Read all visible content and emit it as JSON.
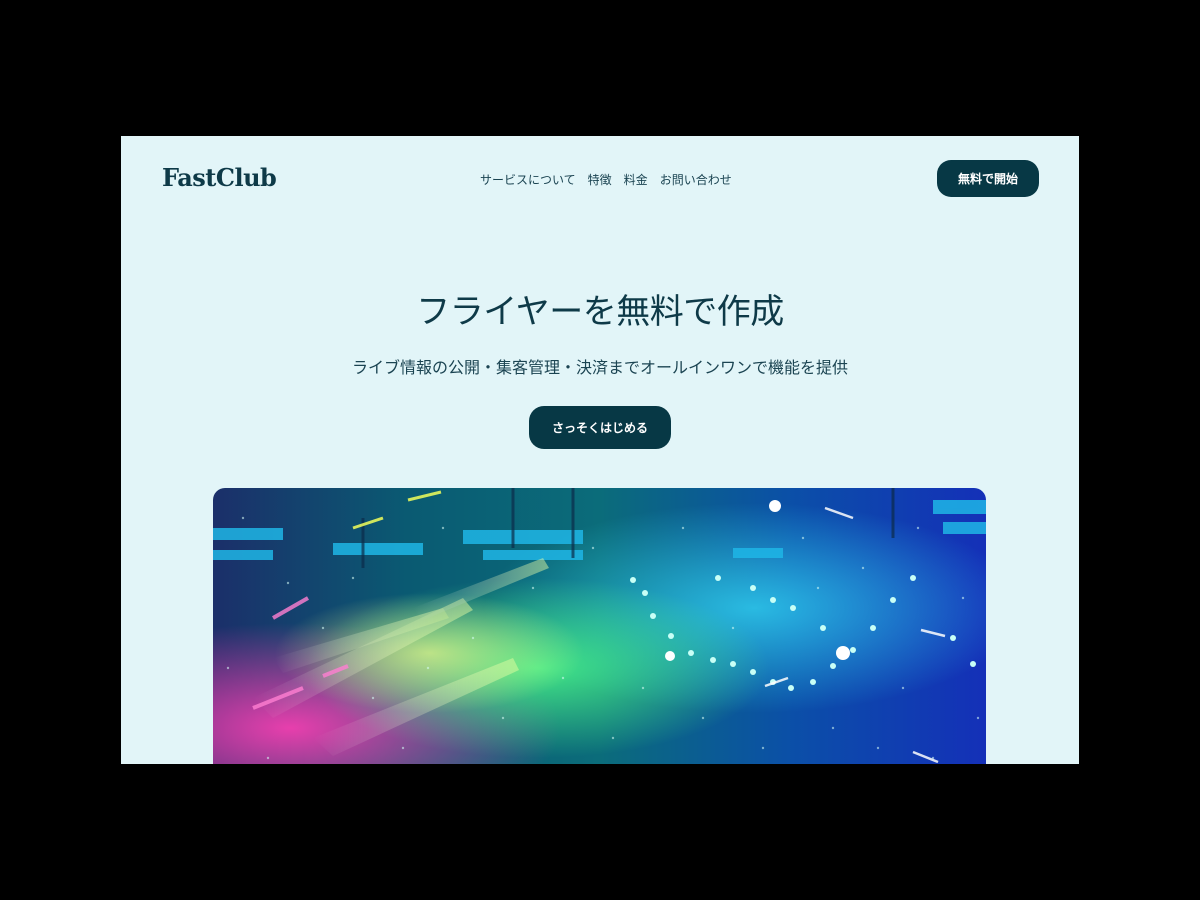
{
  "brand": {
    "logo_text": "FastClub"
  },
  "nav": {
    "links": [
      {
        "label": "サービスについて"
      },
      {
        "label": "特徴"
      },
      {
        "label": "料金"
      },
      {
        "label": "お問い合わせ"
      }
    ],
    "cta_label": "無料で開始"
  },
  "hero": {
    "title": "フライヤーを無料で作成",
    "subtitle": "ライブ情報の公開・集客管理・決済までオールインワンで機能を提供",
    "cta_label": "さっそくはじめる"
  },
  "colors": {
    "page_background": "#e2f5f8",
    "primary_dark": "#073845",
    "text": "#0e3a48",
    "outer_background": "#000000"
  },
  "icons": {
    "hero_image": "concert-stage-lights-image"
  }
}
